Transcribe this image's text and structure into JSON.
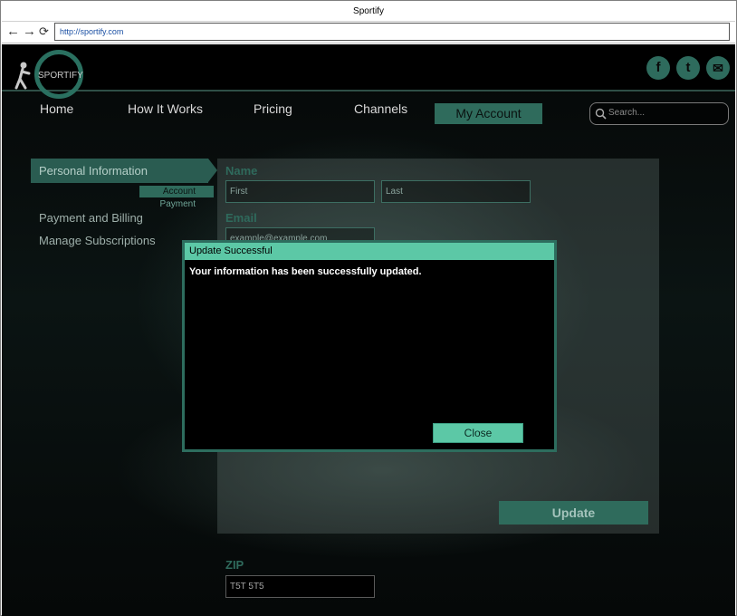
{
  "browser": {
    "title": "Sportify",
    "back_glyph": "←",
    "forward_glyph": "→",
    "reload_glyph": "⟳",
    "url": "http://sportify.com"
  },
  "header": {
    "logo_text": "SPORTIFY",
    "social": [
      {
        "icon": "facebook-icon",
        "label": "f"
      },
      {
        "icon": "twitter-icon",
        "label": "t"
      },
      {
        "icon": "mail-icon",
        "label": "✉"
      }
    ]
  },
  "nav": {
    "items": [
      "Home",
      "How It Works",
      "Pricing",
      "Channels",
      "My Account"
    ],
    "active": "My Account",
    "search_placeholder": "Search..."
  },
  "sidebar": {
    "active_label": "Personal Information",
    "sub_items": [
      "Account",
      "Payment"
    ],
    "items": [
      "Payment and Billing",
      "Manage Subscriptions"
    ]
  },
  "form": {
    "name_label": "Name",
    "first_placeholder": "First",
    "last_placeholder": "Last",
    "email_label": "Email",
    "email_placeholder": "example@example.com",
    "update_label": "Update",
    "zip_label": "ZIP",
    "zip_value": "T5T 5T5"
  },
  "modal": {
    "title": "Update Successful",
    "message": "Your information has been successfully updated.",
    "close_label": "Close"
  },
  "colors": {
    "accent": "#2f6b5c",
    "modal_accent": "#5cc8a6"
  }
}
